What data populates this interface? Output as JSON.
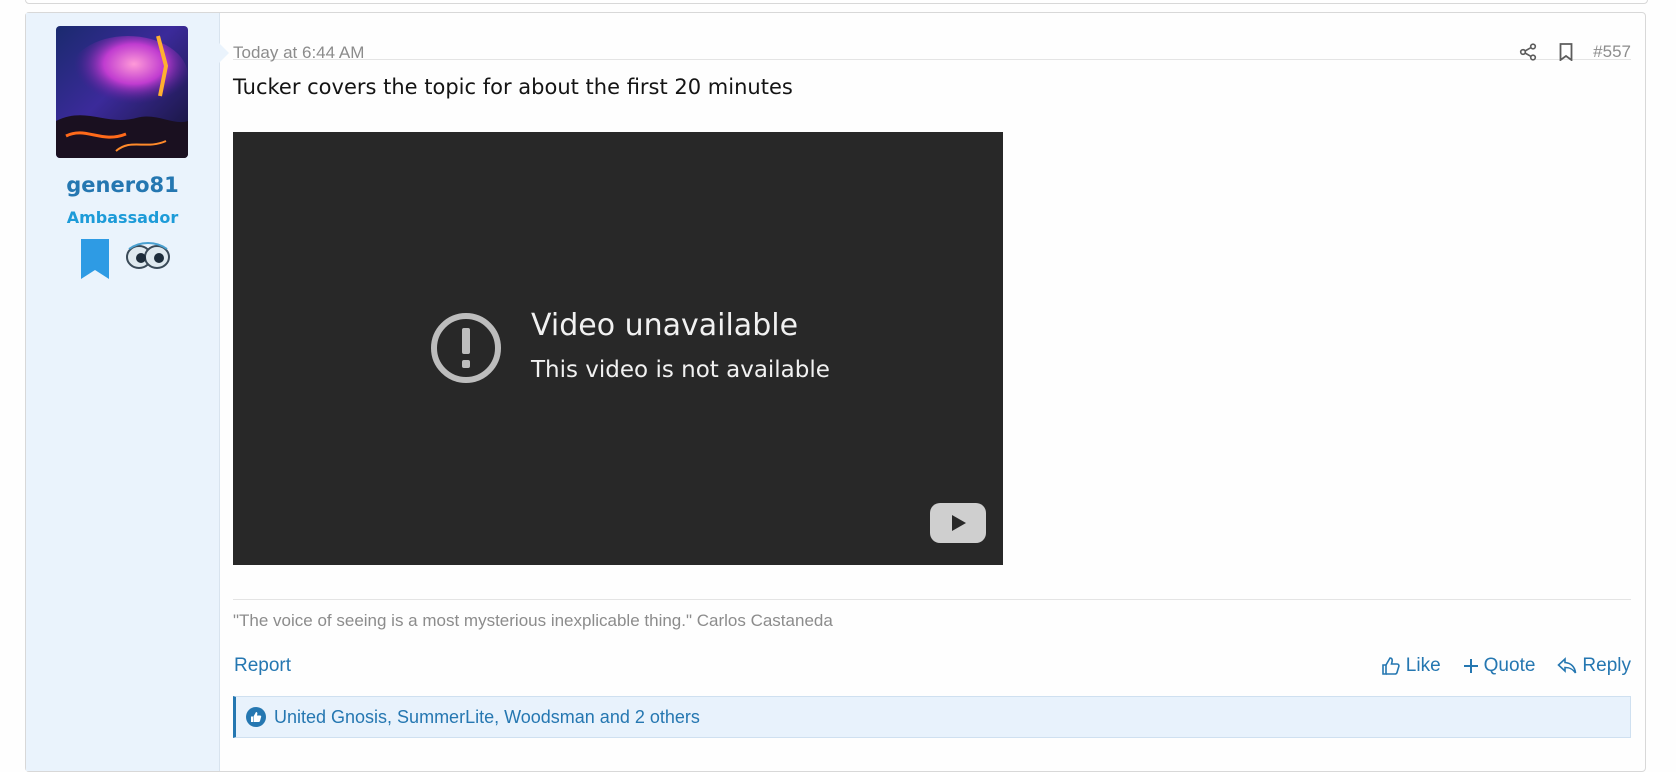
{
  "post": {
    "date": "Today at 6:44 AM",
    "number": "#557",
    "body_text": "Tucker covers the topic for about the first 20 minutes",
    "signature": "\"The voice of seeing is a most mysterious inexplicable thing.\" Carlos Castaneda"
  },
  "user": {
    "name": "genero81",
    "title": "Ambassador"
  },
  "video": {
    "title": "Video unavailable",
    "subtitle": "This video is not available"
  },
  "actions": {
    "report": "Report",
    "like": "Like",
    "quote": "Quote",
    "reply": "Reply"
  },
  "reactions": {
    "summary": "United Gnosis, SummerLite, Woodsman and 2 others"
  },
  "colors": {
    "link": "#2577b1",
    "user_cell_bg": "#eaf3fc",
    "video_bg": "#282828",
    "title_color": "#1d9bd8"
  }
}
